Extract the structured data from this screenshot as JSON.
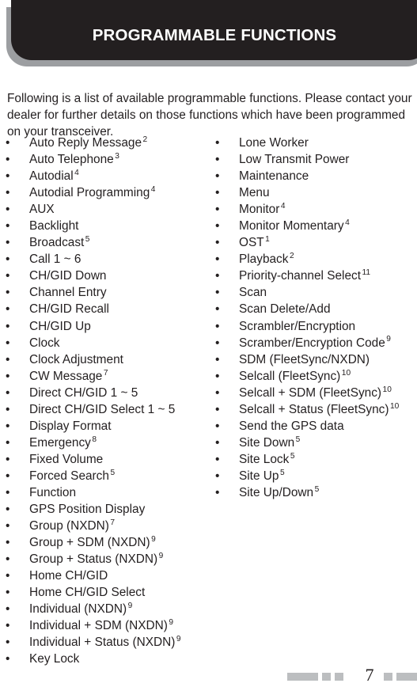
{
  "header": {
    "title": "PROGRAMMABLE FUNCTIONS",
    "background_color": "#231f20",
    "text_color": "#ffffff",
    "shadow_color": "#9c9ea1"
  },
  "intro": {
    "paragraph": "Following is a list of available programmable functions.  Please contact your dealer for further details on those functions which have been programmed on your transceiver."
  },
  "list": {
    "bullet": "•",
    "left_column": [
      {
        "label": "Auto Reply Message",
        "note": "2"
      },
      {
        "label": "Auto Telephone",
        "note": "3"
      },
      {
        "label": "Autodial",
        "note": "4"
      },
      {
        "label": "Autodial Programming",
        "note": "4"
      },
      {
        "label": "AUX",
        "note": ""
      },
      {
        "label": "Backlight",
        "note": ""
      },
      {
        "label": "Broadcast",
        "note": "5"
      },
      {
        "label": "Call 1 ~ 6",
        "note": ""
      },
      {
        "label": "CH/GID Down",
        "note": ""
      },
      {
        "label": "Channel Entry",
        "note": ""
      },
      {
        "label": "CH/GID Recall",
        "note": ""
      },
      {
        "label": "CH/GID Up",
        "note": ""
      },
      {
        "label": "Clock",
        "note": ""
      },
      {
        "label": "Clock Adjustment",
        "note": ""
      },
      {
        "label": "CW Message",
        "note": "7"
      },
      {
        "label": "Direct CH/GID 1 ~ 5",
        "note": ""
      },
      {
        "label": "Direct CH/GID Select 1 ~ 5",
        "note": ""
      },
      {
        "label": "Display Format",
        "note": ""
      },
      {
        "label": "Emergency",
        "note": "8"
      },
      {
        "label": "Fixed Volume",
        "note": ""
      },
      {
        "label": "Forced Search",
        "note": "5"
      },
      {
        "label": "Function",
        "note": ""
      },
      {
        "label": "GPS Position Display",
        "note": ""
      },
      {
        "label": "Group (NXDN)",
        "note": "7"
      },
      {
        "label": "Group + SDM (NXDN)",
        "note": "9"
      },
      {
        "label": "Group + Status (NXDN)",
        "note": "9"
      },
      {
        "label": "Home CH/GID",
        "note": ""
      },
      {
        "label": "Home CH/GID Select",
        "note": ""
      },
      {
        "label": "Individual (NXDN)",
        "note": "9"
      },
      {
        "label": "Individual + SDM (NXDN)",
        "note": "9"
      },
      {
        "label": "Individual + Status (NXDN)",
        "note": "9"
      },
      {
        "label": "Key Lock",
        "note": ""
      }
    ],
    "right_column": [
      {
        "label": "Lone Worker",
        "note": ""
      },
      {
        "label": "Low Transmit Power",
        "note": ""
      },
      {
        "label": "Maintenance",
        "note": ""
      },
      {
        "label": "Menu",
        "note": ""
      },
      {
        "label": "Monitor",
        "note": "4"
      },
      {
        "label": "Monitor Momentary",
        "note": "4"
      },
      {
        "label": "OST",
        "note": "1"
      },
      {
        "label": "Playback",
        "note": "2"
      },
      {
        "label": "Priority-channel Select",
        "note": "11"
      },
      {
        "label": "Scan",
        "note": ""
      },
      {
        "label": "Scan Delete/Add",
        "note": ""
      },
      {
        "label": "Scrambler/Encryption",
        "note": ""
      },
      {
        "label": "Scramber/Encryption Code",
        "note": "9"
      },
      {
        "label": "SDM (FleetSync/NXDN)",
        "note": ""
      },
      {
        "label": "Selcall (FleetSync)",
        "note": "10"
      },
      {
        "label": "Selcall + SDM (FleetSync)",
        "note": "10"
      },
      {
        "label": "Selcall + Status (FleetSync)",
        "note": "10"
      },
      {
        "label": "Send the GPS data",
        "note": ""
      },
      {
        "label": "Site Down",
        "note": "5"
      },
      {
        "label": "Site Lock",
        "note": "5"
      },
      {
        "label": "Site Up",
        "note": "5"
      },
      {
        "label": "Site Up/Down",
        "note": "5"
      }
    ]
  },
  "footer": {
    "page_number": "7",
    "decoration_color": "#bcbec0"
  }
}
